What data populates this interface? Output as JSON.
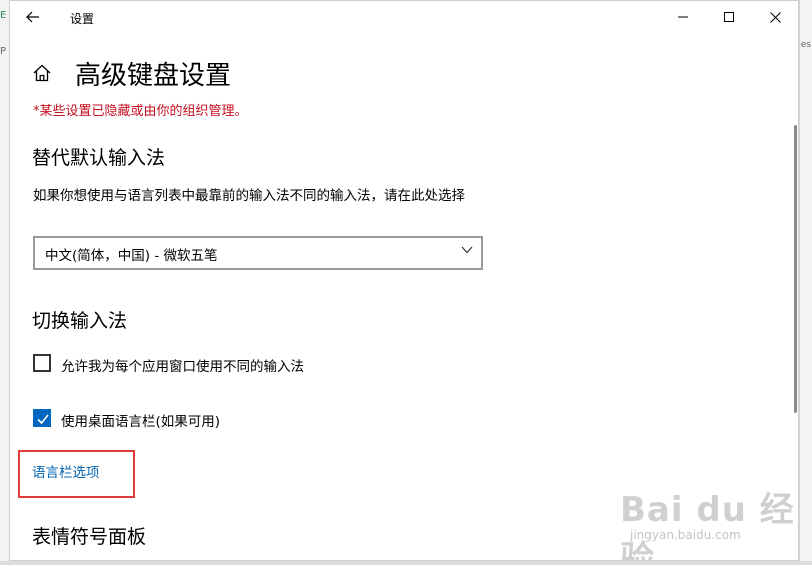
{
  "window": {
    "title": "设置"
  },
  "page": {
    "title": "高级键盘设置",
    "managed_note": "*某些设置已隐藏或由你的组织管理。"
  },
  "override_input": {
    "heading": "替代默认输入法",
    "description": "如果你想使用与语言列表中最靠前的输入法不同的输入法，请在此处选择",
    "selected": "中文(简体，中国) - 微软五笔"
  },
  "switch_input": {
    "heading": "切换输入法",
    "options": [
      {
        "label": "允许我为每个应用窗口使用不同的输入法",
        "checked": false
      },
      {
        "label": "使用桌面语言栏(如果可用)",
        "checked": true
      }
    ],
    "language_bar_link": "语言栏选项"
  },
  "emoji_panel": {
    "heading": "表情符号面板"
  },
  "watermark": {
    "logo": "Bai du 经验",
    "sub": "jingyan.baidu.com"
  },
  "background": {
    "left_glyph_1": "E",
    "left_glyph_2": "P",
    "right_glyph": "es"
  },
  "colors": {
    "accent": "#0067c0",
    "link": "#0063b1",
    "warning_text": "#c50f1f",
    "highlight_box": "#e23b3b"
  },
  "icons": [
    "back-arrow-icon",
    "minimize-icon",
    "maximize-icon",
    "close-icon",
    "home-icon",
    "chevron-down-icon",
    "checkmark-icon"
  ]
}
